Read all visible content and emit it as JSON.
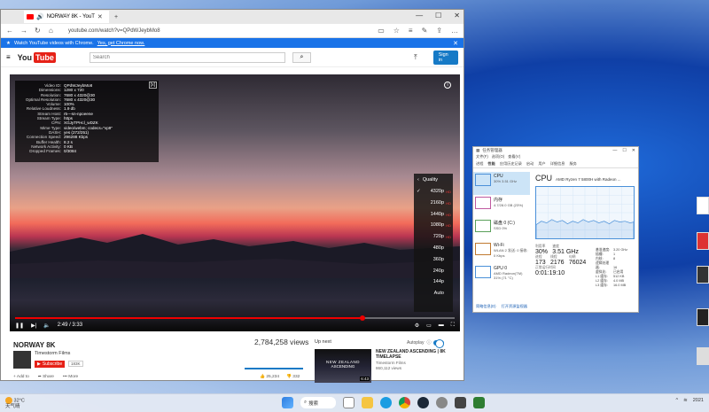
{
  "browser": {
    "tab_title": "NORWAY 8K - YouT",
    "url": "youtube.com/watch?v=QPdWJeybMo8",
    "window_controls": [
      "—",
      "☐",
      "✕"
    ]
  },
  "banner": {
    "message": "Watch YouTube videos with Chrome.",
    "link": "Yes, get Chrome now."
  },
  "yt": {
    "logo_you": "You",
    "logo_tube": "Tube",
    "search_placeholder": "Search",
    "signin": "Sign in"
  },
  "stats": {
    "close_label": "[x]",
    "rows": [
      {
        "k": "Video ID:",
        "v": "QPdWJeybMo8"
      },
      {
        "k": "Dimensions:",
        "v": "1280 x 720"
      },
      {
        "k": "Resolution:",
        "v": "7680 x 4320@30"
      },
      {
        "k": "Optimal Resolution:",
        "v": "7680 x 4320@30"
      },
      {
        "k": "Volume:",
        "v": "100%"
      },
      {
        "k": "Relative Loudness:",
        "v": "1.9 db"
      },
      {
        "k": "Stream Host:",
        "v": "r5---sn-npoeene"
      },
      {
        "k": "Stream Type:",
        "v": "https"
      },
      {
        "k": "CPN:",
        "v": "XGJyTPHcl_wDZK"
      },
      {
        "k": "Mime Type:",
        "v": "video/webm; codecs=\"vp9\""
      },
      {
        "k": "DASH:",
        "v": "yes (272/251)"
      },
      {
        "k": "Connection Speed:",
        "v": "296288 Kbps"
      },
      {
        "k": "Buffer Health:",
        "v": "8.2 s"
      },
      {
        "k": "Network Activity:",
        "v": "0 KB"
      },
      {
        "k": "Dropped Frames:",
        "v": "0/3084"
      }
    ]
  },
  "player": {
    "info_icon": "i",
    "quality_title": "Quality",
    "quality_options": [
      "4320p",
      "2160p",
      "1440p",
      "1080p",
      "720p",
      "480p",
      "360p",
      "240p",
      "144p",
      "Auto"
    ],
    "quality_selected_index": 0,
    "time": "2:49 / 3:33",
    "progress": 0.79
  },
  "video": {
    "title": "NORWAY 8K",
    "channel": "Timestorm Films",
    "subscribe_label": "Subscribe",
    "sub_count": "183K",
    "views": "2,784,258 views",
    "likes": "25,234",
    "dislikes": "332",
    "add_to": "Add to",
    "share": "Share",
    "more": "More"
  },
  "upnext": {
    "heading": "Up next",
    "autoplay": "Autoplay",
    "thumb_line1": "NEW ZEALAND",
    "thumb_line2": "ASCENDING",
    "duration": "6:43",
    "title": "NEW ZEALAND ASCENDING | 8K TIMELAPSE",
    "channel": "Timestorm Films",
    "views": "860,112 views"
  },
  "taskmgr": {
    "title": "任务管理器",
    "menu": [
      "文件(F)",
      "选项(O)",
      "查看(V)"
    ],
    "tabs": [
      "进程",
      "性能",
      "应用历史记录",
      "启动",
      "用户",
      "详细信息",
      "服务"
    ],
    "side": [
      {
        "l1": "CPU",
        "l2": "30% 3.51 GHz"
      },
      {
        "l1": "内存",
        "l2": "4.7/28.0 GB (23%)"
      },
      {
        "l1": "磁盘 0 (C:)",
        "l2": "SSD 0%"
      },
      {
        "l1": "Wi-Fi",
        "l2": "WLAN 2 发送: 0 接收: 0 Kbps"
      },
      {
        "l1": "GPU 0",
        "l2": "AMD Radeon(TM) 31% (71 °C)"
      }
    ],
    "cpu_title": "CPU",
    "cpu_model": "AMD Ryzen 7 5800H with Radeon ...",
    "util_label": "利用率",
    "util": "30%",
    "speed_label": "速度",
    "speed": "3.51 GHz",
    "proc_label": "进程",
    "proc": "173",
    "threads_label": "线程",
    "threads": "2176",
    "handles_label": "句柄",
    "handles": "76024",
    "uptime_label": "正常运行时间",
    "uptime": "0:01:19:10",
    "specs": [
      {
        "k": "基准速度:",
        "v": "3.20 GHz"
      },
      {
        "k": "插槽:",
        "v": "1"
      },
      {
        "k": "内核:",
        "v": "8"
      },
      {
        "k": "逻辑处理器:",
        "v": "16"
      },
      {
        "k": "虚拟化:",
        "v": "已启用"
      },
      {
        "k": "L1 缓存:",
        "v": "512 KB"
      },
      {
        "k": "L2 缓存:",
        "v": "4.0 MB"
      },
      {
        "k": "L3 缓存:",
        "v": "16.0 MB"
      }
    ],
    "bottom_less": "简略信息(D)",
    "bottom_monitor": "打开资源监视器"
  },
  "taskbar": {
    "temp": "32°C",
    "weather_text": "天气晴",
    "search_label": "搜索",
    "year": "2021"
  },
  "colors": {
    "yt_red": "#e62117",
    "chrome_blue": "#1a73e8",
    "signin_blue": "#167ac6"
  }
}
